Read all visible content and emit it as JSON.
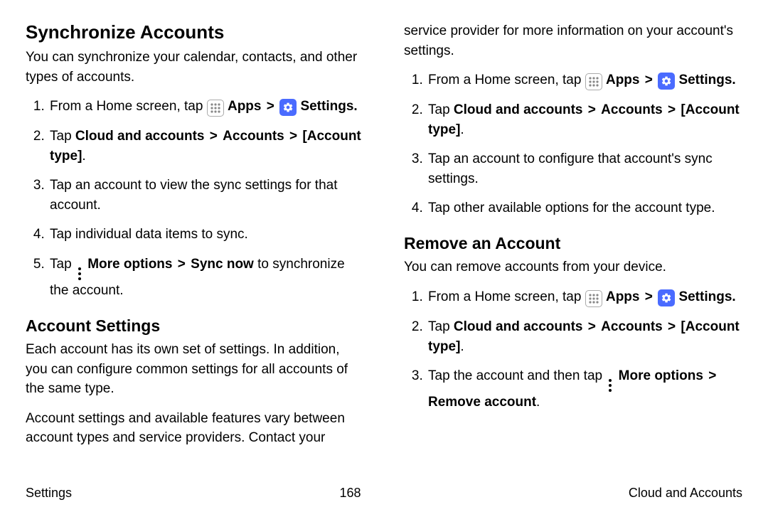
{
  "chevron": ">",
  "labels": {
    "apps": "Apps",
    "settings": "Settings",
    "settings_period": "Settings."
  },
  "left": {
    "sync": {
      "heading": "Synchronize Accounts",
      "intro": "You can synchronize your calendar, contacts, and other types of accounts.",
      "step1_pre": "From a Home screen, tap ",
      "step2_pre": "Tap ",
      "step2_b1": "Cloud and accounts",
      "step2_b2": "Accounts",
      "step2_b3": "[Account type]",
      "step3": "Tap an account to view the sync settings for that account.",
      "step4": "Tap individual data items to sync.",
      "step5_pre": "Tap ",
      "step5_b1": "More options",
      "step5_b2": "Sync now",
      "step5_post": " to synchronize the account."
    },
    "acct_settings": {
      "heading": "Account Settings",
      "intro": "Each account has its own set of settings. In addition, you can configure common settings for all accounts of the same type."
    }
  },
  "right": {
    "top_para": "Account settings and available features vary between account types and service providers. Contact your service provider for more information on your account's settings.",
    "as_step1_pre": "From a Home screen, tap ",
    "as_step2_pre": "Tap ",
    "as_step2_b1": "Cloud and accounts",
    "as_step2_b2": "Accounts",
    "as_step2_b3": "[Account type]",
    "as_step3": "Tap an account to configure that account's sync settings.",
    "as_step4": "Tap other available options for the account type.",
    "remove": {
      "heading": "Remove an Account",
      "intro": "You can remove accounts from your device.",
      "r_step1_pre": "From a Home screen, tap ",
      "r_step2_pre": "Tap ",
      "r_step2_b1": "Cloud and accounts",
      "r_step2_b2": "Accounts",
      "r_step2_b3": "[Account type]",
      "r_step3_pre": "Tap the account and then tap ",
      "r_step3_b1": "More options",
      "r_step3_b2": "Remove account"
    }
  },
  "footer": {
    "left": "Settings",
    "center": "168",
    "right": "Cloud and Accounts"
  }
}
